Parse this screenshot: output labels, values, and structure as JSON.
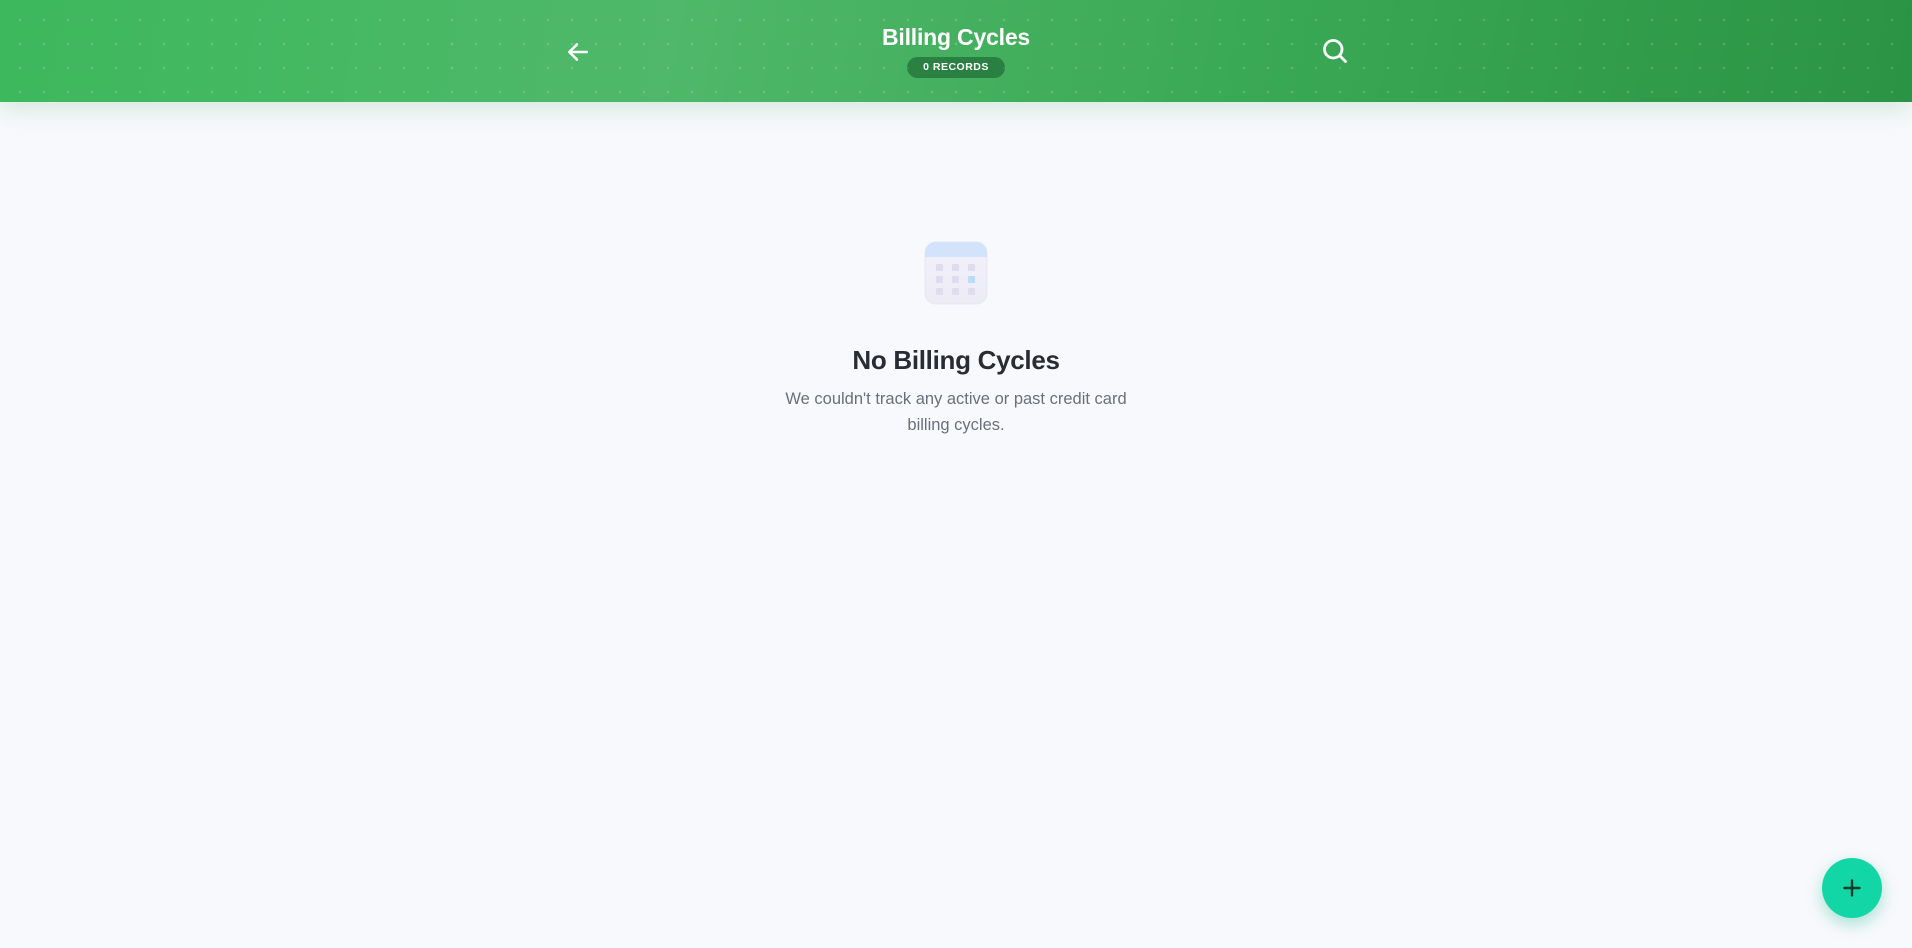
{
  "header": {
    "title": "Billing Cycles",
    "records_badge": "0 RECORDS",
    "back_icon": "arrow-left-icon",
    "search_icon": "search-icon"
  },
  "empty_state": {
    "icon": "calendar-icon",
    "title": "No Billing Cycles",
    "description": "We couldn't track any active or past credit card billing cycles."
  },
  "fab": {
    "icon": "plus-icon"
  },
  "colors": {
    "header_gradient_start": "#3db85c",
    "header_gradient_end": "#2a9444",
    "fab": "#12d6a5",
    "background": "#f8f9fc",
    "title_text": "#2a2c33",
    "description_text": "#6b6f7b"
  }
}
